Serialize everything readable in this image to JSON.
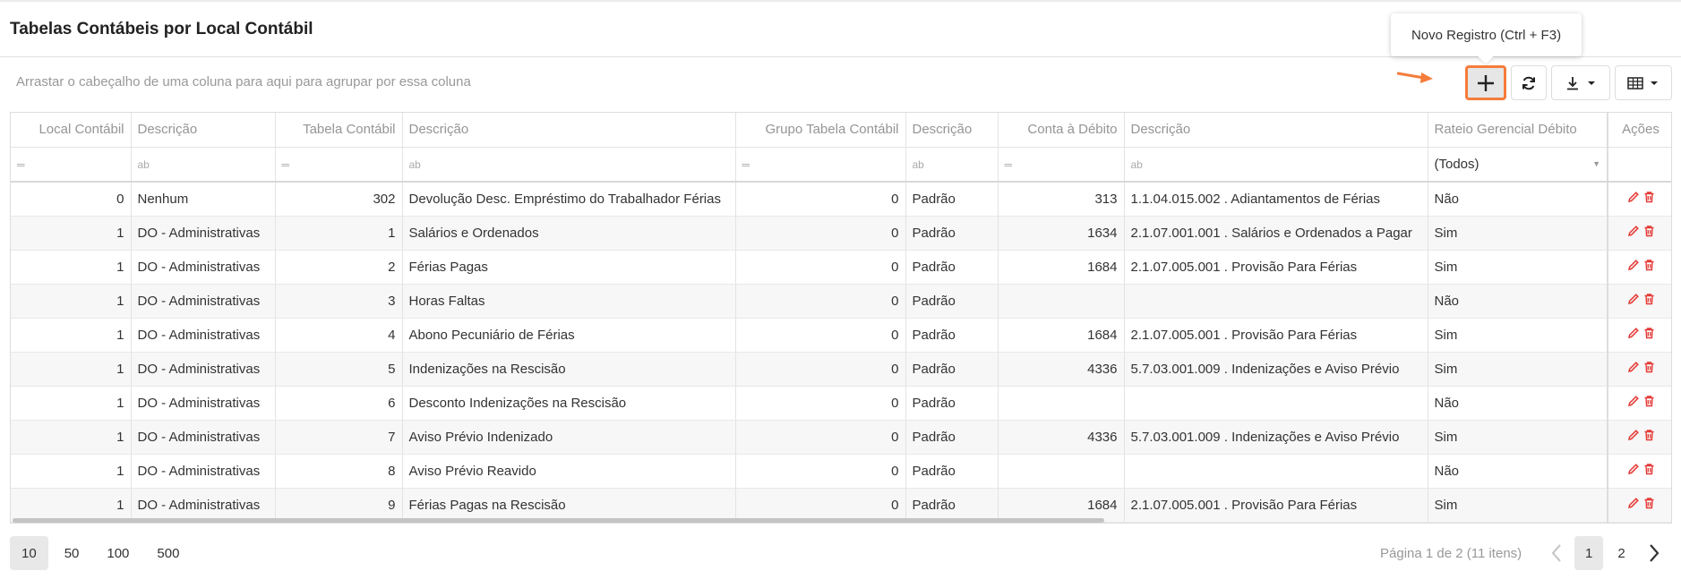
{
  "page": {
    "title": "Tabelas Contábeis por Local Contábil"
  },
  "group_panel": {
    "text": "Arrastar o cabeçalho de uma coluna para aqui para agrupar por essa coluna"
  },
  "tooltip": {
    "text": "Novo Registro (Ctrl + F3)"
  },
  "toolbar": {
    "add_icon": "plus-icon",
    "refresh_icon": "refresh-icon",
    "export_icon": "download-icon",
    "columns_icon": "grid-columns-icon"
  },
  "colors": {
    "accent": "#f57c3b",
    "action": "#e53935"
  },
  "grid": {
    "columns": [
      "Local Contábil",
      "Descrição",
      "Tabela Contábil",
      "Descrição",
      "Grupo Tabela Contábil",
      "Descrição",
      "Conta à Débito",
      "Descrição",
      "Rateio Gerencial Débito",
      "Ações"
    ],
    "filter_select_value": "(Todos)",
    "rows": [
      {
        "local": "0",
        "local_desc": "Nenhum",
        "tabela": "302",
        "tabela_desc": "Devolução Desc. Empréstimo do Trabalhador Férias",
        "grupo": "0",
        "grupo_desc": "Padrão",
        "conta": "313",
        "conta_desc": "1.1.04.015.002  .  Adiantamentos de Férias",
        "rateio": "Não"
      },
      {
        "local": "1",
        "local_desc": "DO - Administrativas",
        "tabela": "1",
        "tabela_desc": "Salários e Ordenados",
        "grupo": "0",
        "grupo_desc": "Padrão",
        "conta": "1634",
        "conta_desc": "2.1.07.001.001  .  Salários e Ordenados a Pagar",
        "rateio": "Sim"
      },
      {
        "local": "1",
        "local_desc": "DO - Administrativas",
        "tabela": "2",
        "tabela_desc": "Férias Pagas",
        "grupo": "0",
        "grupo_desc": "Padrão",
        "conta": "1684",
        "conta_desc": "2.1.07.005.001  .  Provisão Para Férias",
        "rateio": "Sim"
      },
      {
        "local": "1",
        "local_desc": "DO - Administrativas",
        "tabela": "3",
        "tabela_desc": "Horas Faltas",
        "grupo": "0",
        "grupo_desc": "Padrão",
        "conta": "",
        "conta_desc": "",
        "rateio": "Não"
      },
      {
        "local": "1",
        "local_desc": "DO - Administrativas",
        "tabela": "4",
        "tabela_desc": "Abono Pecuniário de Férias",
        "grupo": "0",
        "grupo_desc": "Padrão",
        "conta": "1684",
        "conta_desc": "2.1.07.005.001  .  Provisão Para Férias",
        "rateio": "Sim"
      },
      {
        "local": "1",
        "local_desc": "DO - Administrativas",
        "tabela": "5",
        "tabela_desc": "Indenizações na Rescisão",
        "grupo": "0",
        "grupo_desc": "Padrão",
        "conta": "4336",
        "conta_desc": "5.7.03.001.009  .  Indenizações e Aviso Prévio",
        "rateio": "Sim"
      },
      {
        "local": "1",
        "local_desc": "DO - Administrativas",
        "tabela": "6",
        "tabela_desc": "Desconto Indenizações na Rescisão",
        "grupo": "0",
        "grupo_desc": "Padrão",
        "conta": "",
        "conta_desc": "",
        "rateio": "Não"
      },
      {
        "local": "1",
        "local_desc": "DO - Administrativas",
        "tabela": "7",
        "tabela_desc": "Aviso Prévio Indenizado",
        "grupo": "0",
        "grupo_desc": "Padrão",
        "conta": "4336",
        "conta_desc": "5.7.03.001.009  .  Indenizações e Aviso Prévio",
        "rateio": "Sim"
      },
      {
        "local": "1",
        "local_desc": "DO - Administrativas",
        "tabela": "8",
        "tabela_desc": "Aviso Prévio Reavido",
        "grupo": "0",
        "grupo_desc": "Padrão",
        "conta": "",
        "conta_desc": "",
        "rateio": "Não"
      },
      {
        "local": "1",
        "local_desc": "DO - Administrativas",
        "tabela": "9",
        "tabela_desc": "Férias Pagas na Rescisão",
        "grupo": "0",
        "grupo_desc": "Padrão",
        "conta": "1684",
        "conta_desc": "2.1.07.005.001  .  Provisão Para Férias",
        "rateio": "Sim"
      }
    ]
  },
  "pager": {
    "page_sizes": [
      "10",
      "50",
      "100",
      "500"
    ],
    "active_size": "10",
    "info": "Página 1 de 2 (11 itens)",
    "pages": [
      "1",
      "2"
    ],
    "current_page": "1"
  }
}
